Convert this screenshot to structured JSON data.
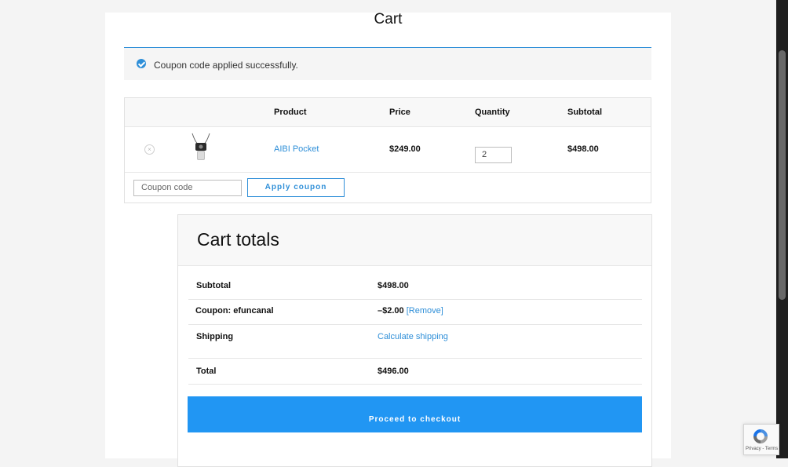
{
  "page_title": "Cart",
  "notice": {
    "message": "Coupon code applied successfully."
  },
  "cart_table": {
    "headers": {
      "product": "Product",
      "price": "Price",
      "quantity": "Quantity",
      "subtotal": "Subtotal"
    },
    "items": [
      {
        "remove_symbol": "×",
        "name": "AIBI Pocket",
        "price": "$249.00",
        "quantity": "2",
        "subtotal": "$498.00",
        "thumbnail_icon": "product-thumbnail-icon"
      }
    ]
  },
  "coupon": {
    "placeholder": "Coupon code",
    "apply_label": "Apply coupon"
  },
  "cart_totals": {
    "title": "Cart totals",
    "subtotal_label": "Subtotal",
    "subtotal_value": "$498.00",
    "coupon_label": "Coupon: efuncanal",
    "coupon_value": "–$2.00",
    "coupon_remove": "[Remove]",
    "shipping_label": "Shipping",
    "shipping_link": "Calculate shipping",
    "total_label": "Total",
    "total_value": "$496.00",
    "checkout_label": "Proceed to checkout"
  },
  "recaptcha": {
    "text": "Privacy - Terms"
  },
  "colors": {
    "accent": "#2f8fd8",
    "checkout_bg": "#2196f3"
  }
}
